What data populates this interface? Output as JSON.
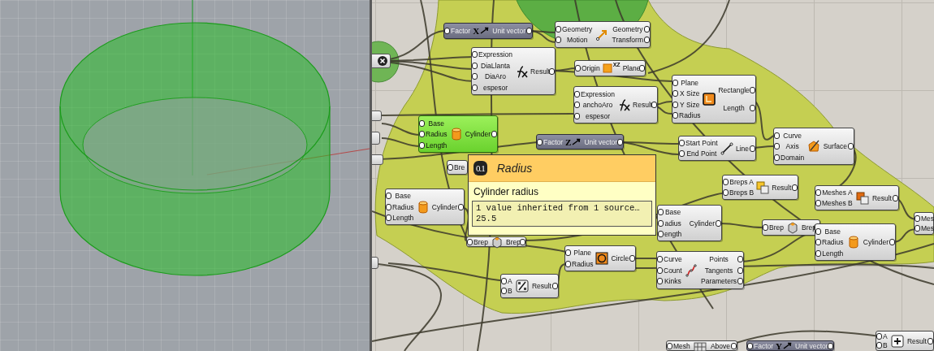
{
  "canvas": {
    "nodes": [
      {
        "kind": "vector",
        "selected": false,
        "inputs": [
          "Factor"
        ],
        "outputs": [
          "Unit vector"
        ],
        "icon_text": "X"
      },
      {
        "kind": "component",
        "selected": false,
        "inputs": [
          "Geometry",
          "Motion"
        ],
        "outputs": [
          "Geometry",
          "Transform"
        ]
      },
      {
        "kind": "component",
        "selected": false,
        "inputs": [
          "Expression",
          "DiaLlanta",
          "DiaAro",
          "espesor"
        ],
        "outputs": [
          "Result"
        ]
      },
      {
        "kind": "component",
        "selected": false,
        "inputs": [
          "Origin"
        ],
        "outputs": [
          "Plane"
        ],
        "icon_text": "XZ"
      },
      {
        "kind": "component",
        "selected": false,
        "inputs": [
          "Expression",
          "anchoAro",
          "espesor"
        ],
        "outputs": [
          "Result"
        ]
      },
      {
        "kind": "component",
        "selected": false,
        "inputs": [
          "Plane",
          "X Size",
          "Y Size",
          "Radius"
        ],
        "outputs": [
          "Rectangle",
          "Length"
        ]
      },
      {
        "kind": "component",
        "selected": true,
        "inputs": [
          "Base",
          "Radius",
          "Length"
        ],
        "outputs": [
          "Cylinder"
        ]
      },
      {
        "kind": "vector",
        "selected": false,
        "inputs": [
          "Factor"
        ],
        "outputs": [
          "Unit vector"
        ],
        "icon_text": "Z"
      },
      {
        "kind": "component",
        "selected": false,
        "inputs": [
          "Start Point",
          "End Point"
        ],
        "outputs": [
          "Line"
        ]
      },
      {
        "kind": "component",
        "selected": false,
        "inputs": [
          "Curve",
          "Axis",
          "Domain"
        ],
        "outputs": [
          "Surface"
        ]
      },
      {
        "kind": "component",
        "selected": false,
        "inputs": [
          "Bre"
        ]
      },
      {
        "kind": "component",
        "selected": false,
        "inputs": [
          "Base",
          "Radius",
          "Length"
        ],
        "outputs": [
          "Cylinder"
        ]
      },
      {
        "kind": "component",
        "selected": false,
        "inputs": [
          "Breps A",
          "Breps B"
        ],
        "outputs": [
          "Result"
        ]
      },
      {
        "kind": "component",
        "selected": false,
        "inputs": [
          "Meshes A",
          "Meshes B"
        ],
        "outputs": [
          "Result"
        ]
      },
      {
        "kind": "component",
        "selected": false,
        "inputs": [
          "Base",
          "adius",
          "ength"
        ],
        "outputs": [
          "Cylinder"
        ]
      },
      {
        "kind": "component",
        "selected": false,
        "inputs": [
          "Brep"
        ],
        "outputs": [
          "Brep"
        ]
      },
      {
        "kind": "component",
        "selected": false,
        "inputs": [
          "Brep"
        ],
        "outputs": [
          "Brep"
        ]
      },
      {
        "kind": "component",
        "selected": false,
        "inputs": [
          "Base",
          "Radius",
          "Length"
        ],
        "outputs": [
          "Cylinder"
        ]
      },
      {
        "kind": "component",
        "selected": false,
        "inputs": [
          "Mes",
          "Mes"
        ]
      },
      {
        "kind": "component",
        "selected": false,
        "inputs": [
          "Plane",
          "Radius"
        ],
        "outputs": [
          "Circle"
        ]
      },
      {
        "kind": "component",
        "selected": false,
        "inputs": [
          "Curve",
          "Count",
          "Kinks"
        ],
        "outputs": [
          "Points",
          "Tangents",
          "Parameters"
        ]
      },
      {
        "kind": "component",
        "selected": false,
        "inputs": [
          "A",
          "B"
        ],
        "outputs": [
          "Result"
        ]
      },
      {
        "kind": "component",
        "selected": false,
        "inputs": [
          "Mesh"
        ],
        "outputs": [
          "Above"
        ]
      },
      {
        "kind": "vector",
        "selected": false,
        "inputs": [
          "Factor"
        ],
        "outputs": [
          "Unit vector"
        ],
        "icon_text": "Y"
      },
      {
        "kind": "component",
        "selected": false,
        "inputs": [
          "A",
          "B"
        ],
        "outputs": [
          "Result"
        ]
      }
    ]
  },
  "tooltip": {
    "badge": "0.1",
    "title": "Radius",
    "description": "Cylinder radius",
    "value_lines": [
      "1 value inherited from 1 source…",
      "25.5"
    ]
  }
}
